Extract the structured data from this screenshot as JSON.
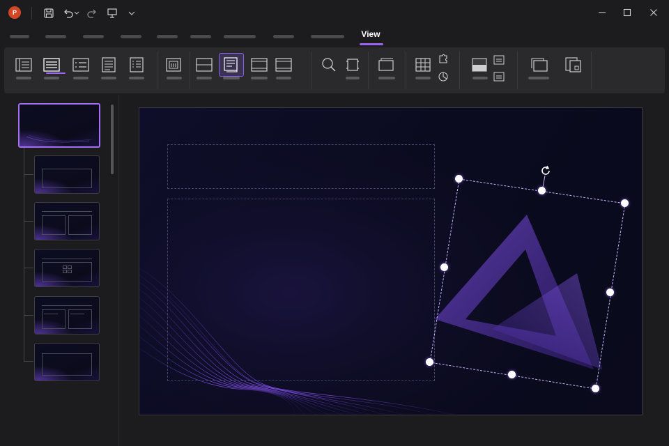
{
  "app": {
    "logo_letter": "P",
    "accent_color": "#9a63f0",
    "brand_color": "#d24726"
  },
  "quick_access": [
    {
      "name": "save-icon"
    },
    {
      "name": "undo-icon"
    },
    {
      "name": "redo-icon"
    },
    {
      "name": "present-icon"
    },
    {
      "name": "customize-icon"
    }
  ],
  "tabs": {
    "active_label": "View"
  },
  "slides": {
    "count": 6,
    "selected_index": 1
  }
}
